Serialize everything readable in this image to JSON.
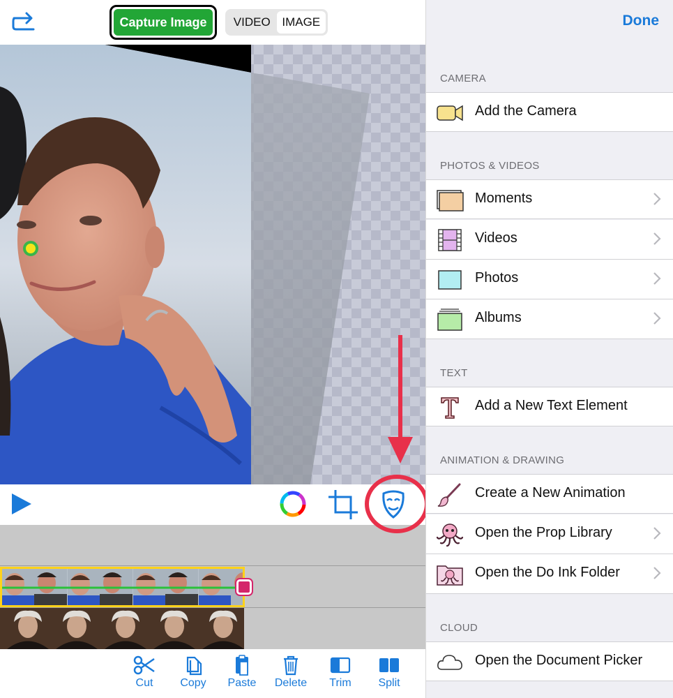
{
  "toolbar": {
    "capture_label": "Capture Image",
    "mode_video": "VIDEO",
    "mode_image": "IMAGE"
  },
  "edit_bar": {
    "cut": "Cut",
    "copy": "Copy",
    "paste": "Paste",
    "delete": "Delete",
    "trim": "Trim",
    "split": "Split"
  },
  "panel": {
    "done_label": "Done",
    "sections": {
      "camera": "CAMERA",
      "photos": "PHOTOS & VIDEOS",
      "text": "TEXT",
      "animation": "ANIMATION & DRAWING",
      "cloud": "CLOUD"
    },
    "items": {
      "add_camera": "Add the Camera",
      "moments": "Moments",
      "videos": "Videos",
      "photos": "Photos",
      "albums": "Albums",
      "new_text": "Add a New Text Element",
      "new_animation": "Create a New Animation",
      "prop_library": "Open the Prop Library",
      "doink_folder": "Open the Do Ink Folder",
      "document_picker": "Open the Document Picker"
    }
  },
  "colors": {
    "accent": "#1a7ad9",
    "capture_green": "#22a636",
    "annotation_red": "#e8304a",
    "clip_border": "#ffd21a",
    "trim_handle": "#d4256a"
  },
  "icons": {
    "undo": "redo-arrow-icon",
    "play": "play-icon",
    "color": "color-wheel-icon",
    "crop": "crop-icon",
    "mask": "mask-icon"
  }
}
